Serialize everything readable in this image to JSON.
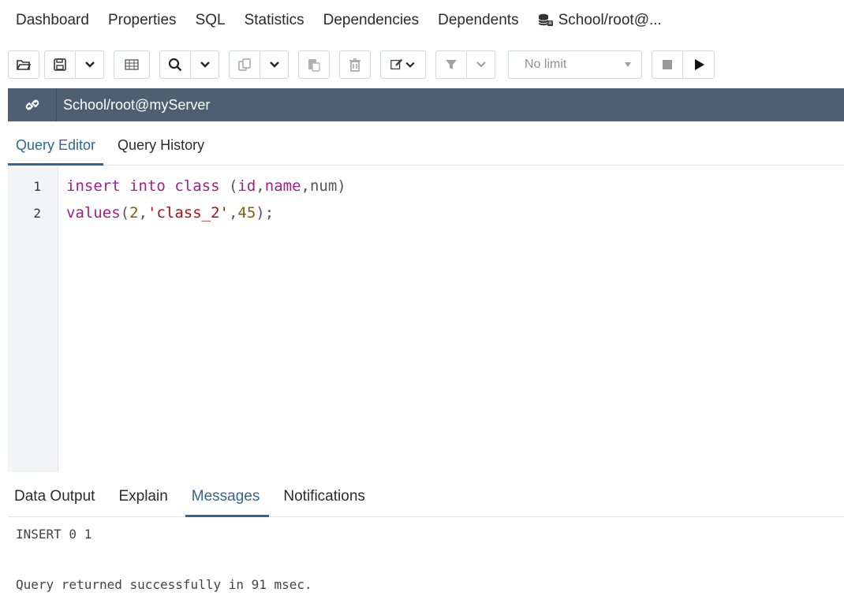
{
  "top_tabs": [
    "Dashboard",
    "Properties",
    "SQL",
    "Statistics",
    "Dependencies",
    "Dependents"
  ],
  "db_tab": {
    "label": "School/root@...",
    "icon": "database-icon"
  },
  "toolbar": {
    "limit_label": "No limit",
    "icons": [
      "open-folder-icon",
      "save-icon",
      "chevron-down-icon",
      "grid-icon",
      "search-icon",
      "copy-icon",
      "paste-icon",
      "delete-icon",
      "edit-icon",
      "filter-icon",
      "stop-icon",
      "play-icon"
    ]
  },
  "connection": {
    "label": "School/root@myServer",
    "icon": "connection-icon"
  },
  "query_tabs": [
    "Query Editor",
    "Query History"
  ],
  "editor": {
    "line_numbers": [
      "1",
      "2"
    ],
    "lines": [
      [
        {
          "t": "insert",
          "c": "kw"
        },
        {
          "t": " ",
          "c": "plain"
        },
        {
          "t": "into",
          "c": "kw"
        },
        {
          "t": " ",
          "c": "plain"
        },
        {
          "t": "class",
          "c": "kw"
        },
        {
          "t": " (",
          "c": "plain"
        },
        {
          "t": "id",
          "c": "kw"
        },
        {
          "t": ",",
          "c": "plain"
        },
        {
          "t": "name",
          "c": "kw"
        },
        {
          "t": ",num)",
          "c": "plain"
        }
      ],
      [
        {
          "t": "values",
          "c": "kw"
        },
        {
          "t": "(",
          "c": "plain"
        },
        {
          "t": "2",
          "c": "num"
        },
        {
          "t": ",",
          "c": "plain"
        },
        {
          "t": "'class_2'",
          "c": "str"
        },
        {
          "t": ",",
          "c": "plain"
        },
        {
          "t": "45",
          "c": "num"
        },
        {
          "t": ");",
          "c": "plain"
        }
      ]
    ]
  },
  "result_tabs": [
    "Data Output",
    "Explain",
    "Messages",
    "Notifications"
  ],
  "active_result_tab": "Messages",
  "messages": [
    "INSERT 0 1",
    "Query returned successfully in 91 msec."
  ],
  "colors": {
    "accent": "#326690",
    "conn_bar": "#4f5f72",
    "keyword": "#a31f88",
    "string": "#a31515",
    "number": "#8a5a00"
  }
}
